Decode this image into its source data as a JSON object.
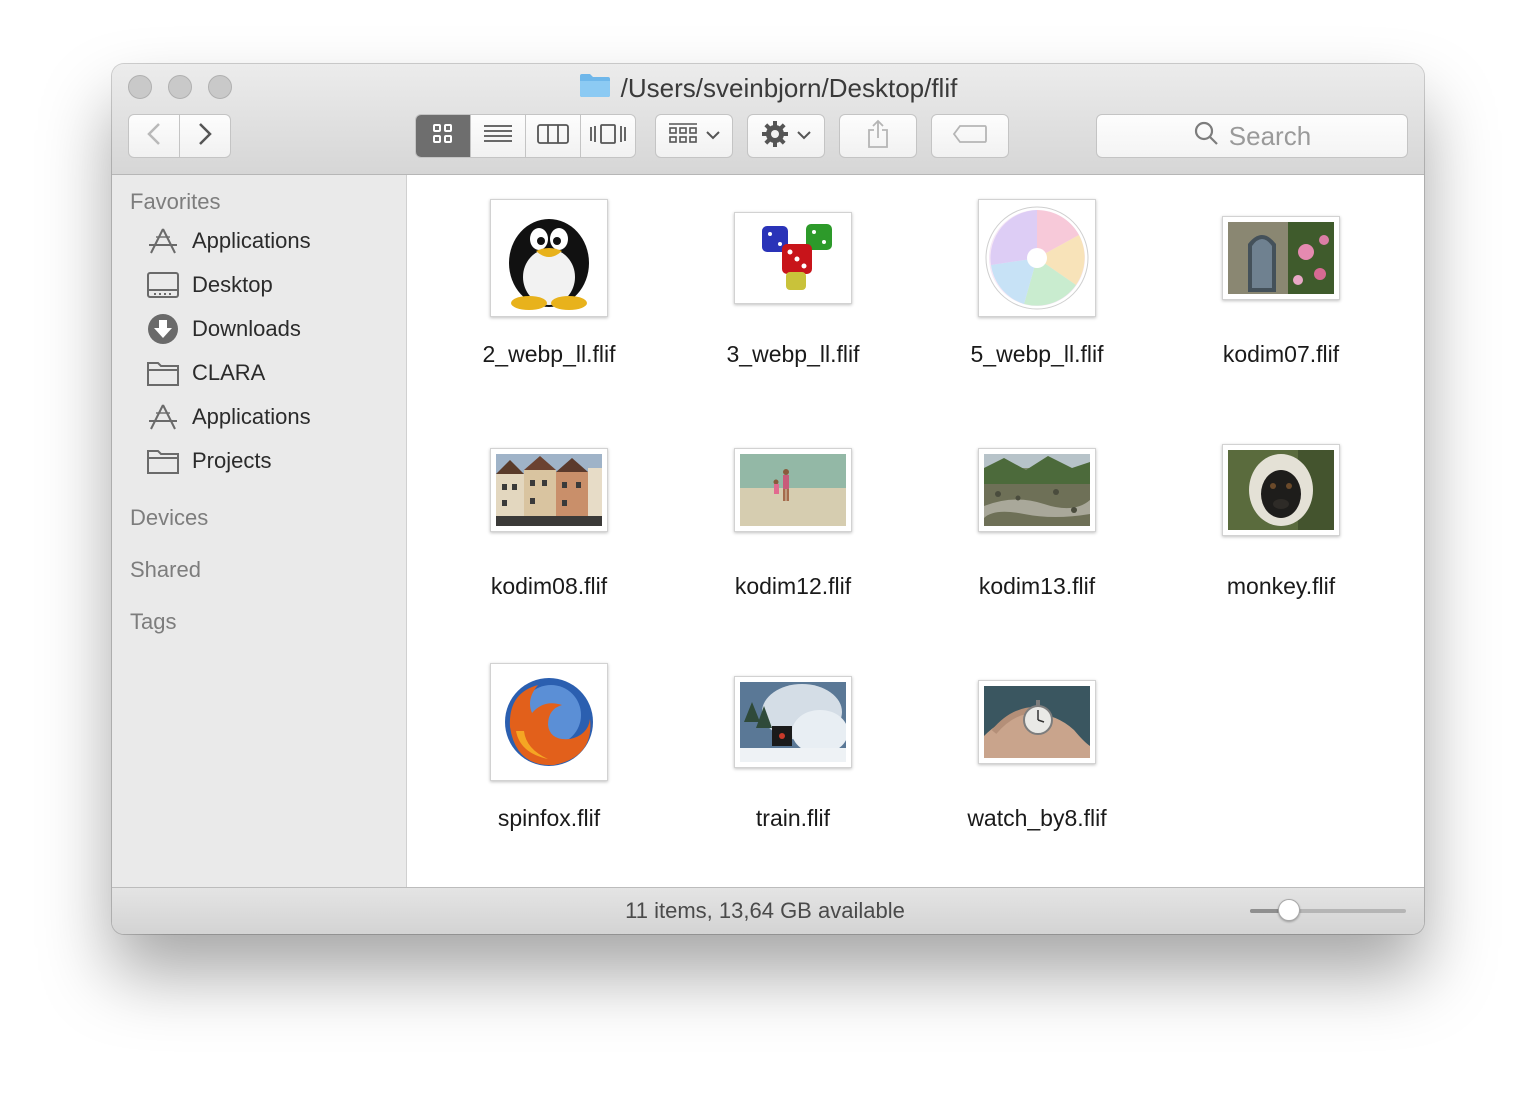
{
  "window": {
    "title": "/Users/sveinbjorn/Desktop/flif",
    "traffic_lights": [
      "close-button",
      "minimize-button",
      "zoom-button"
    ]
  },
  "toolbar": {
    "back_icon": "chevron-left-icon",
    "forward_icon": "chevron-right-icon",
    "view_modes": [
      "icon-view",
      "list-view",
      "column-view",
      "cover-flow-view"
    ],
    "active_view": "icon-view",
    "arrange_icon": "arrange-grid-icon",
    "action_icon": "gear-icon",
    "share_icon": "share-icon",
    "tags_icon": "tag-icon",
    "search_placeholder": "Search"
  },
  "sidebar": {
    "favorites_header": "Favorites",
    "favorites": [
      {
        "label": "Applications",
        "icon": "applications-icon"
      },
      {
        "label": "Desktop",
        "icon": "desktop-icon"
      },
      {
        "label": "Downloads",
        "icon": "downloads-icon"
      },
      {
        "label": "CLARA",
        "icon": "folder-icon"
      },
      {
        "label": "Applications",
        "icon": "applications-icon"
      },
      {
        "label": "Projects",
        "icon": "folder-icon"
      }
    ],
    "devices_header": "Devices",
    "shared_header": "Shared",
    "tags_header": "Tags"
  },
  "files": [
    {
      "name": "2_webp_ll.flif",
      "thumb": "penguin"
    },
    {
      "name": "3_webp_ll.flif",
      "thumb": "dice"
    },
    {
      "name": "5_webp_ll.flif",
      "thumb": "color-wheel"
    },
    {
      "name": "kodim07.flif",
      "thumb": "window-flowers"
    },
    {
      "name": "kodim08.flif",
      "thumb": "houses"
    },
    {
      "name": "kodim12.flif",
      "thumb": "beach"
    },
    {
      "name": "kodim13.flif",
      "thumb": "river"
    },
    {
      "name": "monkey.flif",
      "thumb": "monkey"
    },
    {
      "name": "spinfox.flif",
      "thumb": "firefox"
    },
    {
      "name": "train.flif",
      "thumb": "train"
    },
    {
      "name": "watch_by8.flif",
      "thumb": "watch"
    }
  ],
  "status": {
    "text": "11 items, 13,64 GB available",
    "icon_size_slider": 0.25
  },
  "colors": {
    "folder_blue": "#6fb7ea",
    "active_segment": "#6e6e6e"
  }
}
